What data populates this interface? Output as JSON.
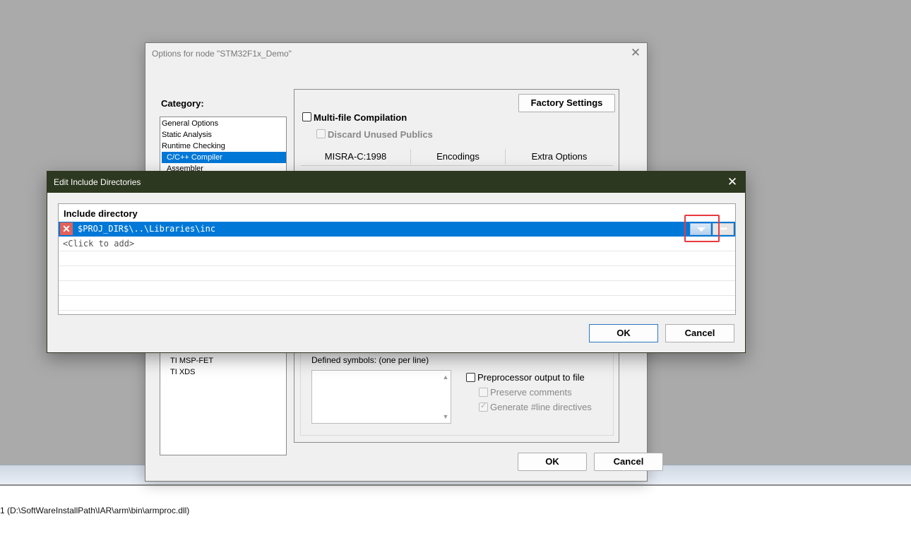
{
  "background": {
    "log_line": "1 (D:\\SoftWareInstallPath\\IAR\\arm\\bin\\armproc.dll)"
  },
  "options_dialog": {
    "title": "Options for node \"STM32F1x_Demo\"",
    "close_glyph": "✕",
    "category_label": "Category:",
    "categories": [
      "General Options",
      "Static Analysis",
      "Runtime Checking",
      "C/C++ Compiler",
      "Assembler",
      "TI MSP-FET",
      "TI XDS"
    ],
    "selected_category": "C/C++ Compiler",
    "factory_settings": "Factory Settings",
    "multifile": "Multi-file Compilation",
    "discard_unused": "Discard Unused Publics",
    "tabs": [
      "MISRA-C:1998",
      "Encodings",
      "Extra Options"
    ],
    "defined_symbols": "Defined symbols: (one per line)",
    "preproc_output": "Preprocessor output to file",
    "preserve_comments": "Preserve comments",
    "generate_line": "Generate #line directives",
    "ok": "OK",
    "cancel": "Cancel"
  },
  "include_dialog": {
    "title": "Edit Include Directories",
    "close_glyph": "✕",
    "column_header": "Include directory",
    "entries": [
      "$PROJ_DIR$\\..\\Libraries\\inc"
    ],
    "add_placeholder": "<Click to add>",
    "delete_glyph": "✕",
    "more_glyph": "•••",
    "ok": "OK",
    "cancel": "Cancel"
  },
  "colors": {
    "selection": "#0078d7",
    "title_bar": "#2d3820",
    "highlight_box": "#e8393f",
    "delete": "#e0625b"
  }
}
